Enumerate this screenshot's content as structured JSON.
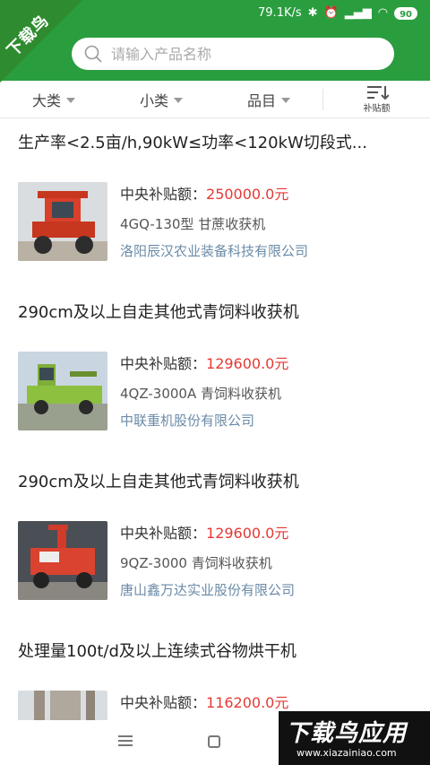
{
  "status": {
    "speed": "79.1K/s",
    "battery": "90"
  },
  "badge": {
    "text": "下载鸟"
  },
  "search": {
    "placeholder": "请输入产品名称"
  },
  "filters": {
    "category": "大类",
    "subcategory": "小类",
    "item": "品目",
    "sort_label": "补贴额"
  },
  "products": [
    {
      "title": "生产率<2.5亩/h,90kW≤功率<120kW切段式...",
      "subsidy_label": "中央补贴额：",
      "subsidy_amount": "250000.0元",
      "model": "4GQ-130型 甘蔗收获机",
      "company": "洛阳辰汉农业装备科技有限公司"
    },
    {
      "title": "290cm及以上自走其他式青饲料收获机",
      "subsidy_label": "中央补贴额：",
      "subsidy_amount": "129600.0元",
      "model": "4QZ-3000A 青饲料收获机",
      "company": "中联重机股份有限公司"
    },
    {
      "title": "290cm及以上自走其他式青饲料收获机",
      "subsidy_label": "中央补贴额：",
      "subsidy_amount": "129600.0元",
      "model": "9QZ-3000 青饲料收获机",
      "company": "唐山鑫万达实业股份有限公司"
    },
    {
      "title": "处理量100t/d及以上连续式谷物烘干机",
      "subsidy_label": "中央补贴额：",
      "subsidy_amount": "116200.0元",
      "model": "",
      "company": ""
    }
  ],
  "watermark": {
    "logo": "下载鸟应用",
    "url": "www.xiazainiao.com"
  }
}
